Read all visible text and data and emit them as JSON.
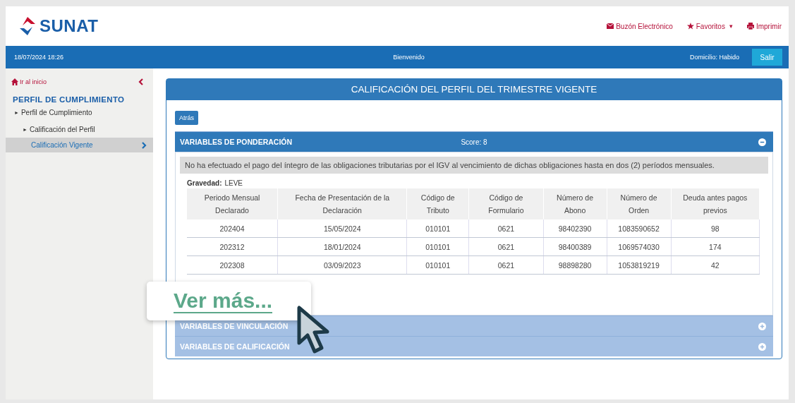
{
  "header": {
    "logo": "SUNAT",
    "links": [
      {
        "kind": "mail",
        "label": "Buzón Electrónico"
      },
      {
        "kind": "favorites",
        "label": "Favoritos",
        "caret": "▾"
      },
      {
        "kind": "print",
        "label": "Imprimir"
      }
    ]
  },
  "topbar": {
    "datetime": "18/07/2024 18:26",
    "welcome": "Bienvenido",
    "status": "Domicilio: Habido",
    "logout": "Salir"
  },
  "sidebar": {
    "home": "Ir al inicio",
    "section": "PERFIL DE CUMPLIMIENTO",
    "items": [
      {
        "marker": "►",
        "label": "Perfil de Cumplimiento",
        "selected": false,
        "children": [
          {
            "marker": "►",
            "label": "Calificación del Perfil",
            "selected": false,
            "children": [
              {
                "label": "Calificación Vigente",
                "selected": true
              }
            ]
          }
        ]
      }
    ]
  },
  "panel": {
    "title": "CALIFICACIÓN DEL PERFIL DEL TRIMESTRE VIGENTE",
    "back": "Atrás",
    "sections": [
      {
        "title": "VARIABLES DE PONDERACIÓN",
        "score": "Score: 8",
        "expanded": true,
        "message": "No ha efectuado el pago del íntegro de las obligaciones tributarias por el IGV al vencimiento de dichas obligaciones hasta en dos (2) períodos mensuales.",
        "severity_label": "Gravedad:",
        "severity": "LEVE",
        "columns": [
          "Periodo Mensual Declarado",
          "Fecha de Presentación de la Declaración",
          "Código de Tributo",
          "Código de Formulario",
          "Número de Abono",
          "Número de Orden",
          "Deuda antes pagos previos"
        ],
        "rows": [
          [
            "202404",
            "15/05/2024",
            "010101",
            "0621",
            "98402390",
            "1083590652",
            "98"
          ],
          [
            "202312",
            "18/01/2024",
            "010101",
            "0621",
            "98400389",
            "1069574030",
            "174"
          ],
          [
            "202308",
            "03/09/2023",
            "010101",
            "0621",
            "98898280",
            "1053819219",
            "42"
          ]
        ]
      },
      {
        "title": "VARIABLES DE VINCULACIÓN",
        "expanded": false
      },
      {
        "title": "VARIABLES DE CALIFICACIÓN",
        "expanded": false
      }
    ]
  },
  "callout": {
    "link": "Ver más..."
  }
}
